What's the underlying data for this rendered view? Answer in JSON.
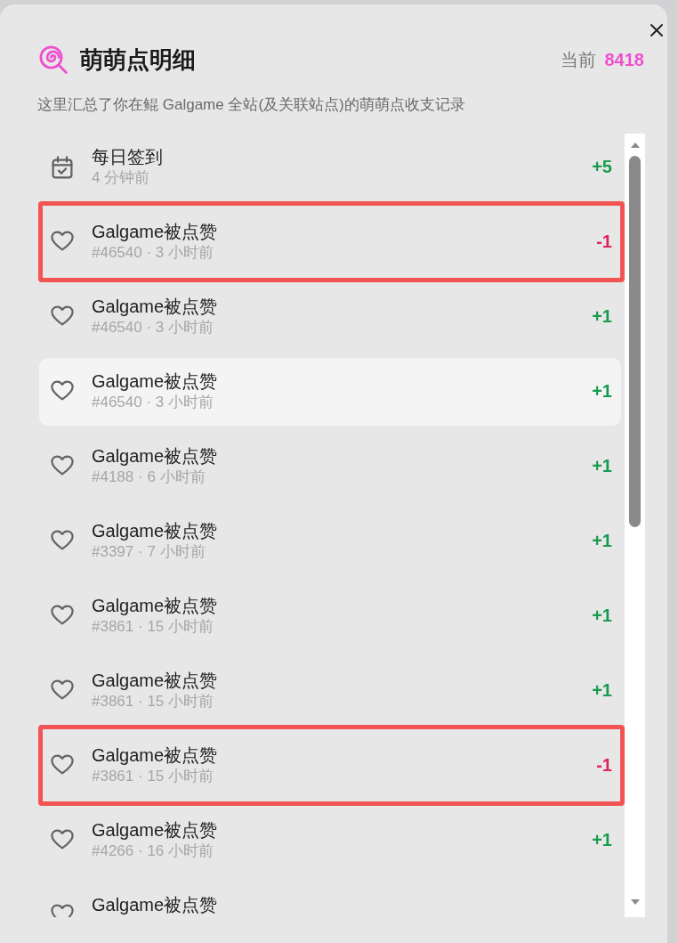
{
  "dialog": {
    "title": "萌萌点明细",
    "balance_label": "当前",
    "balance": "8418",
    "description": "这里汇总了你在鲲 Galgame 全站(及关联站点)的萌萌点收支记录"
  },
  "records": [
    {
      "kind": "checkin",
      "title": "每日签到",
      "meta": "4 分钟前",
      "amount": "+5",
      "negative": false,
      "hovered": false,
      "marked": false
    },
    {
      "kind": "like",
      "title": "Galgame被点赞",
      "meta": "#46540 · 3 小时前",
      "amount": "-1",
      "negative": true,
      "hovered": false,
      "marked": true
    },
    {
      "kind": "like",
      "title": "Galgame被点赞",
      "meta": "#46540 · 3 小时前",
      "amount": "+1",
      "negative": false,
      "hovered": false,
      "marked": false
    },
    {
      "kind": "like",
      "title": "Galgame被点赞",
      "meta": "#46540 · 3 小时前",
      "amount": "+1",
      "negative": false,
      "hovered": true,
      "marked": false
    },
    {
      "kind": "like",
      "title": "Galgame被点赞",
      "meta": "#4188 · 6 小时前",
      "amount": "+1",
      "negative": false,
      "hovered": false,
      "marked": false
    },
    {
      "kind": "like",
      "title": "Galgame被点赞",
      "meta": "#3397 · 7 小时前",
      "amount": "+1",
      "negative": false,
      "hovered": false,
      "marked": false
    },
    {
      "kind": "like",
      "title": "Galgame被点赞",
      "meta": "#3861 · 15 小时前",
      "amount": "+1",
      "negative": false,
      "hovered": false,
      "marked": false
    },
    {
      "kind": "like",
      "title": "Galgame被点赞",
      "meta": "#3861 · 15 小时前",
      "amount": "+1",
      "negative": false,
      "hovered": false,
      "marked": false
    },
    {
      "kind": "like",
      "title": "Galgame被点赞",
      "meta": "#3861 · 15 小时前",
      "amount": "-1",
      "negative": true,
      "hovered": false,
      "marked": true
    },
    {
      "kind": "like",
      "title": "Galgame被点赞",
      "meta": "#4266 · 16 小时前",
      "amount": "+1",
      "negative": false,
      "hovered": false,
      "marked": false
    },
    {
      "kind": "like",
      "title": "Galgame被点赞",
      "hovered": false,
      "marked": false
    }
  ]
}
